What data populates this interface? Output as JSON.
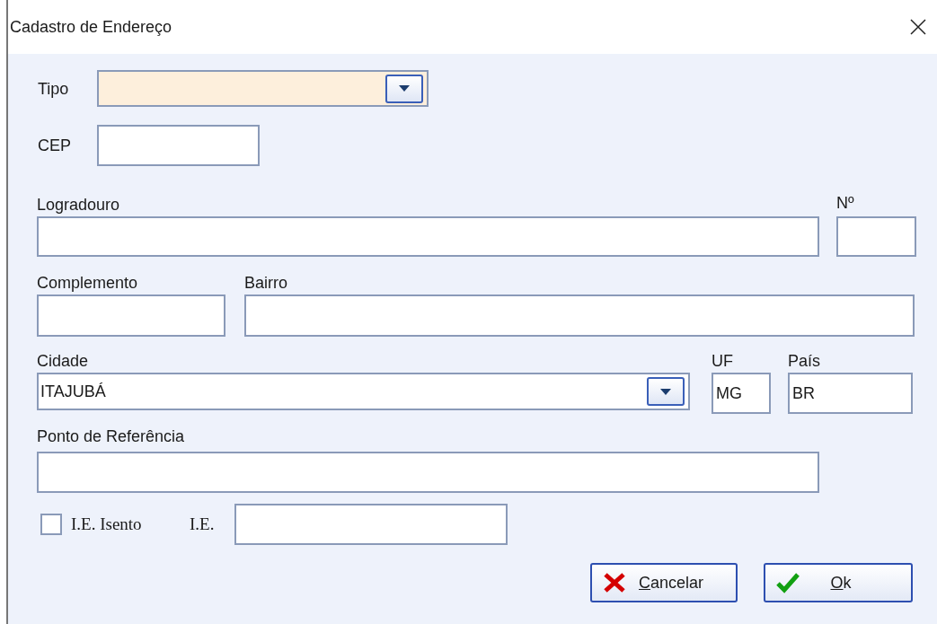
{
  "window": {
    "title": "Cadastro de Endereço"
  },
  "tipo": {
    "label": "Tipo",
    "focused": true
  },
  "cep": {
    "label": "CEP"
  },
  "logradouro": {
    "label": "Logradouro"
  },
  "numero": {
    "label": "Nº"
  },
  "complemento": {
    "label": "Complemento"
  },
  "bairro": {
    "label": "Bairro"
  },
  "cidade": {
    "label": "Cidade",
    "value": "ITAJUBÁ",
    "focused": false
  },
  "uf": {
    "label": "UF",
    "value": "MG"
  },
  "pais": {
    "label": "País",
    "value": "BR"
  },
  "ponto_referencia": {
    "label": "Ponto de Referência"
  },
  "ie_isento": {
    "label": "I.E. Isento",
    "checked": false
  },
  "ie": {
    "label": "I.E."
  },
  "buttons": [
    {
      "label": "Cancelar",
      "kind": "cancel"
    },
    {
      "label": "Ok",
      "kind": "ok"
    }
  ]
}
